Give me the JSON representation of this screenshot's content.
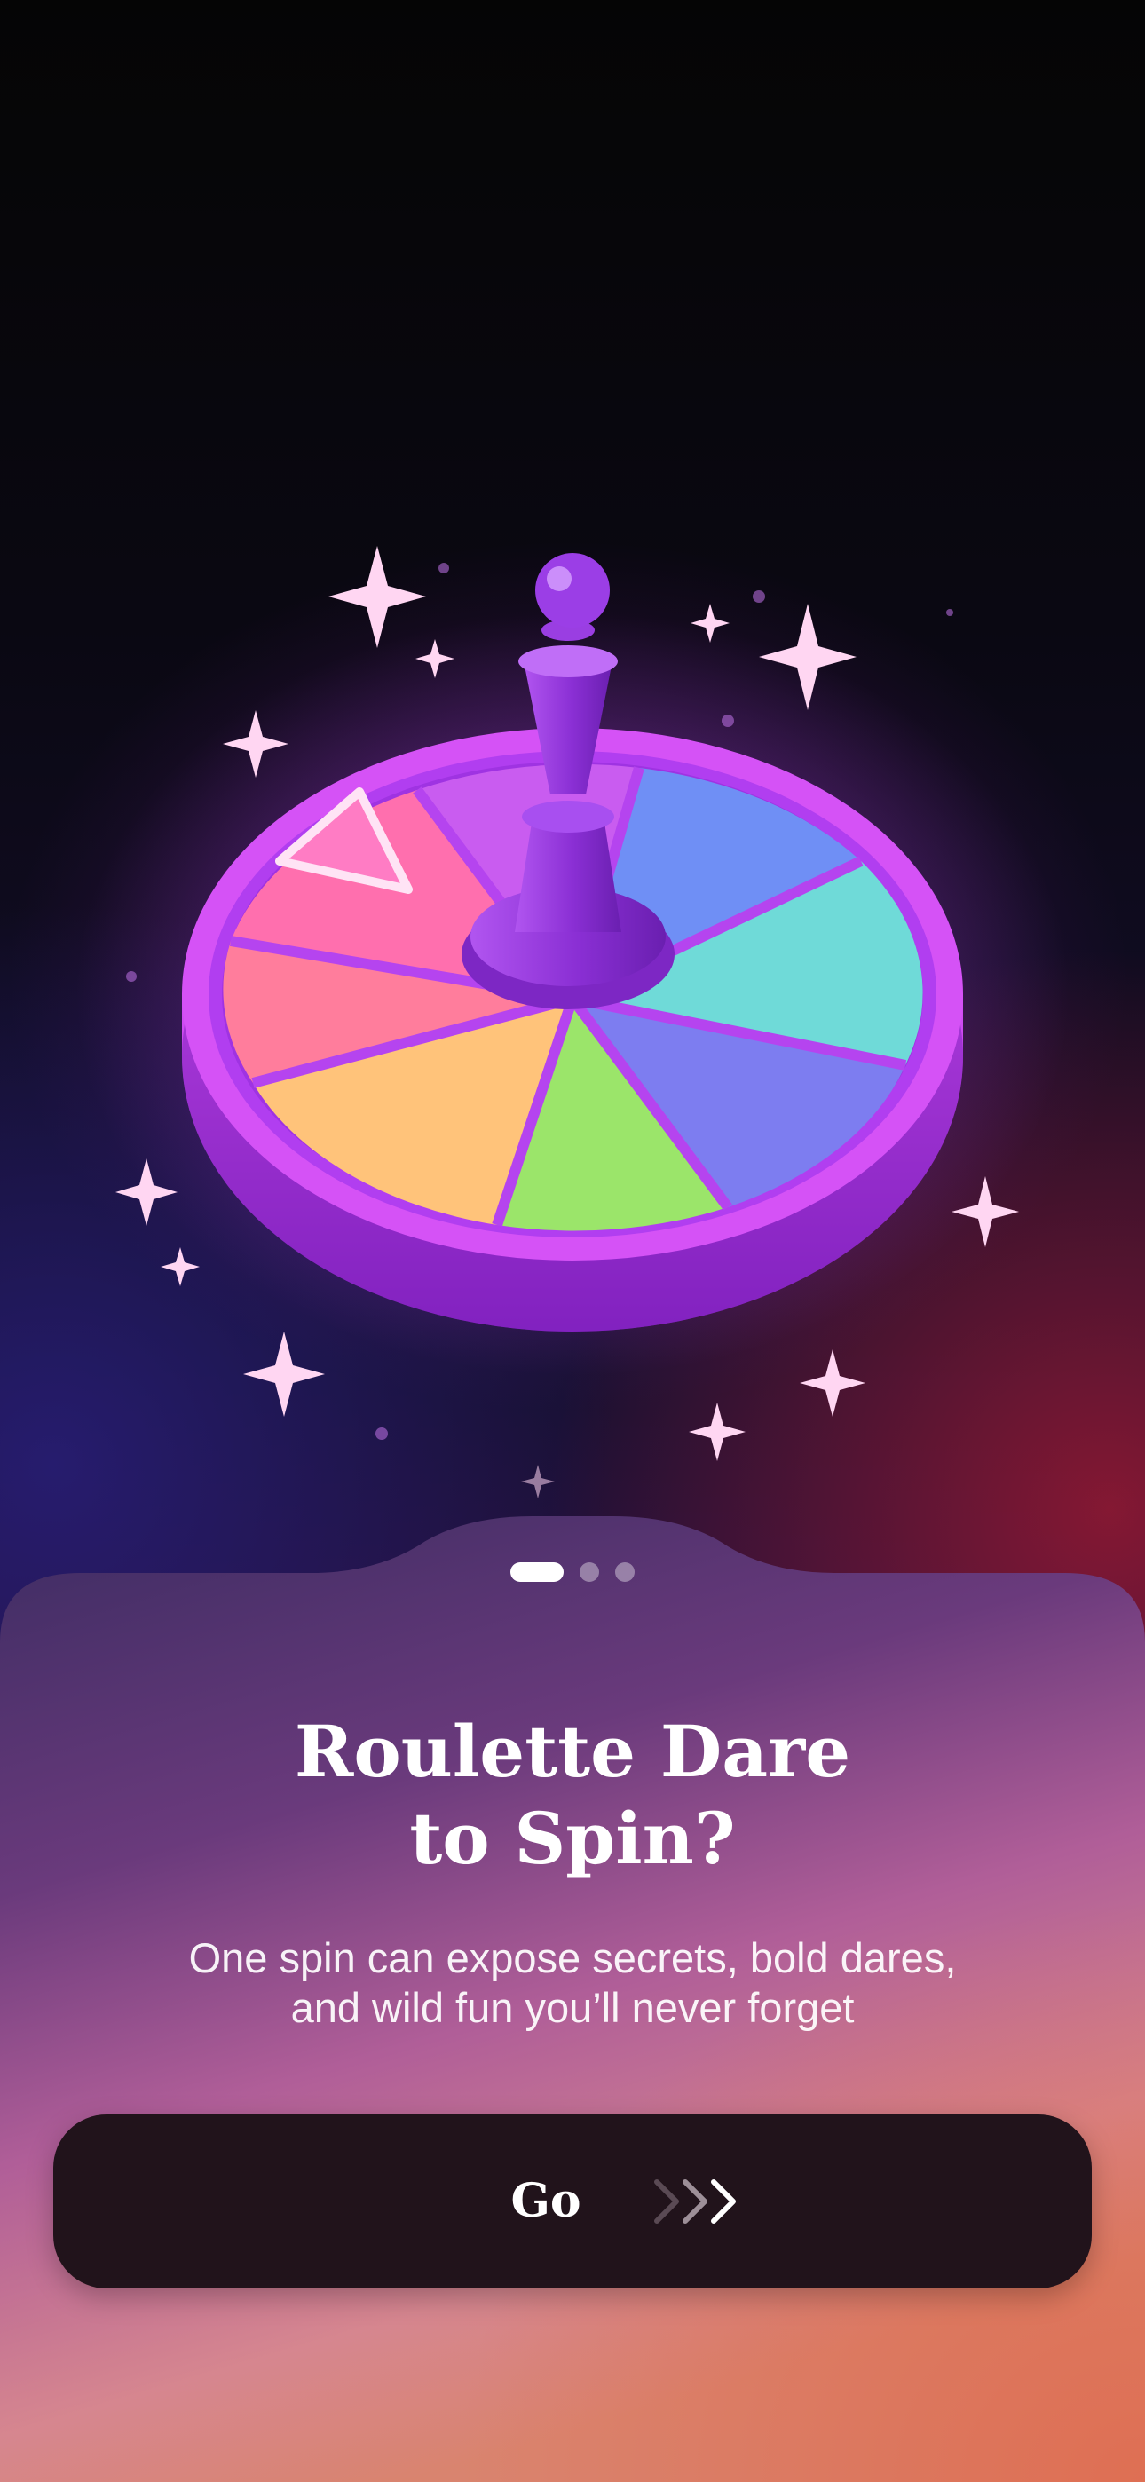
{
  "onboarding": {
    "illustration": {
      "subject": "roulette wheel with purple game piece and sparkles",
      "segment_colors": [
        "#ff6fae",
        "#ffc37a",
        "#9be56a",
        "#7d7df0",
        "#6fdad8",
        "#6f8ff5",
        "#c95cf0"
      ],
      "accent": "#b94cf5"
    },
    "pagination": {
      "total": 3,
      "active_index": 0
    },
    "title_line1": "Roulette Dare",
    "title_line2": "to Spin?",
    "subtitle_line1": "One spin can expose secrets, bold dares,",
    "subtitle_line2": "and wild fun you’ll never forget",
    "cta": {
      "label": "Go",
      "icon": "triple-chevron-right-icon"
    }
  },
  "colors": {
    "sheet_top": "#3e2d66",
    "sheet_bottom": "#d9848f",
    "button_bg": "#21131b",
    "text": "#ffffff"
  }
}
